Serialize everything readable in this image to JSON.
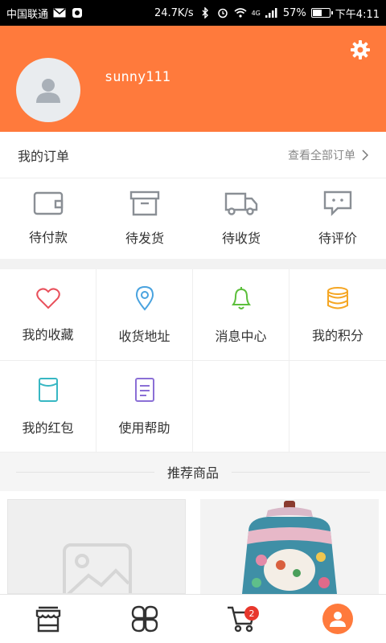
{
  "status_bar": {
    "carrier": "中国联通",
    "speed": "24.7K/s",
    "signal_label": "4G",
    "battery": "57%",
    "battery_level": 0.57,
    "time": "下午4:11"
  },
  "profile": {
    "username": "sunny111",
    "avatar_icon": "default-user-icon",
    "settings_icon": "gear-icon",
    "color": "#ff7a3c"
  },
  "orders": {
    "title": "我的订单",
    "view_all": "查看全部订单",
    "items": [
      {
        "label": "待付款",
        "icon": "wallet-icon"
      },
      {
        "label": "待发货",
        "icon": "box-icon"
      },
      {
        "label": "待收货",
        "icon": "truck-icon"
      },
      {
        "label": "待评价",
        "icon": "comment-icon"
      }
    ]
  },
  "menu": {
    "items": [
      {
        "label": "我的收藏",
        "icon": "heart-icon",
        "color": "#e8505b"
      },
      {
        "label": "收货地址",
        "icon": "location-pin-icon",
        "color": "#4aa3df"
      },
      {
        "label": "消息中心",
        "icon": "bell-icon",
        "color": "#5cbf3c"
      },
      {
        "label": "我的积分",
        "icon": "coins-icon",
        "color": "#f5a623"
      },
      {
        "label": "我的红包",
        "icon": "red-packet-icon",
        "color": "#37b7c3"
      },
      {
        "label": "使用帮助",
        "icon": "help-document-icon",
        "color": "#8b6fd6"
      }
    ]
  },
  "recommend": {
    "title": "推荐商品"
  },
  "tabbar": {
    "items": [
      {
        "icon": "shop-icon"
      },
      {
        "icon": "category-icon"
      },
      {
        "icon": "cart-icon",
        "badge": "2"
      },
      {
        "icon": "user-icon"
      }
    ]
  }
}
